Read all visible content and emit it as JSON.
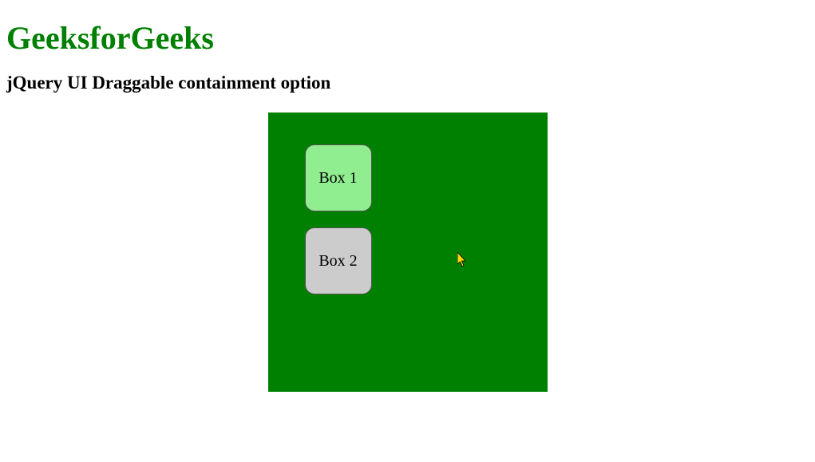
{
  "header": {
    "title": "GeeksforGeeks",
    "subtitle": "jQuery UI Draggable containment option"
  },
  "boxes": {
    "box1": {
      "label": "Box 1"
    },
    "box2": {
      "label": "Box 2"
    }
  }
}
